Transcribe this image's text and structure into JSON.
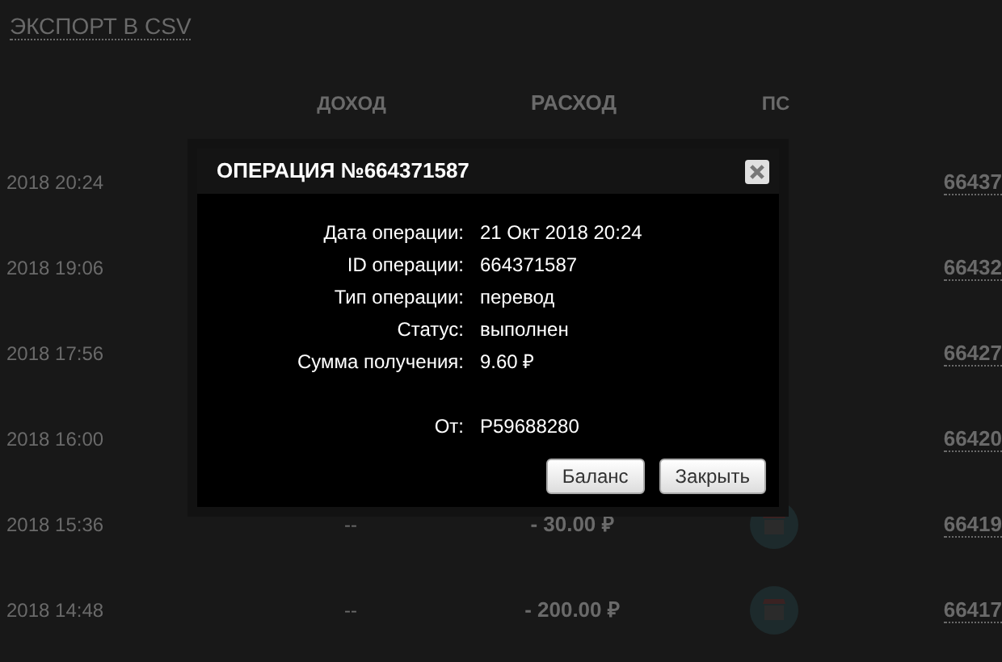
{
  "export_link": "ЭКСПОРТ В CSV",
  "table": {
    "columns": [
      "ДОХОД",
      "РАСХОД",
      "ПС"
    ],
    "rows": [
      {
        "date": "2018 20:24",
        "id": "66437"
      },
      {
        "date": "2018 19:06",
        "id": "66432"
      },
      {
        "date": "2018 17:56",
        "id": "66427"
      },
      {
        "date": "2018 16:00",
        "id": "66420"
      },
      {
        "date": "2018 15:36",
        "income": "--",
        "expense": "- 30.00 ₽",
        "ps_icon": true,
        "id": "66419"
      },
      {
        "date": "2018 14:48",
        "income": "--",
        "expense": "- 200.00 ₽",
        "ps_icon": true,
        "id": "66417"
      }
    ]
  },
  "modal": {
    "title": "ОПЕРАЦИЯ №664371587",
    "fields": [
      {
        "label": "Дата операции:",
        "value": "21 Окт 2018 20:24"
      },
      {
        "label": "ID операции:",
        "value": "664371587"
      },
      {
        "label": "Тип операции:",
        "value": "перевод"
      },
      {
        "label": "Статус:",
        "value": "выполнен"
      },
      {
        "label": "Сумма получения:",
        "value": "9.60 ₽"
      }
    ],
    "sender": {
      "label": "От:",
      "value": "P59688280"
    },
    "buttons": [
      "Баланс",
      "Закрыть"
    ]
  }
}
